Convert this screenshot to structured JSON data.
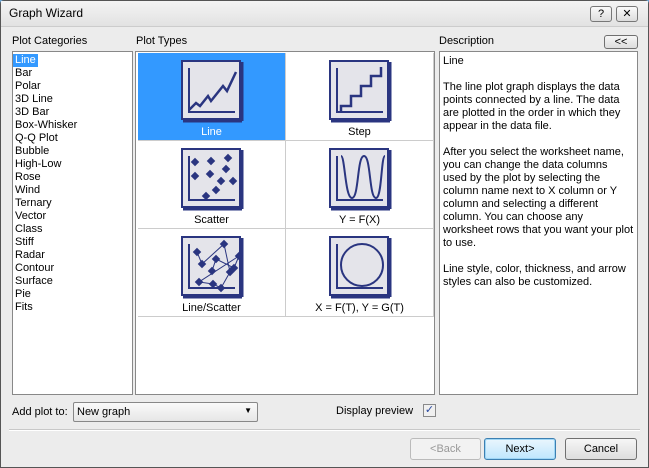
{
  "window": {
    "title": "Graph Wizard",
    "help_label": "?",
    "close_label": "✕"
  },
  "categories": {
    "label": "Plot Categories",
    "items": [
      "Line",
      "Bar",
      "Polar",
      "3D Line",
      "3D Bar",
      "Box-Whisker",
      "Q-Q Plot",
      "Bubble",
      "High-Low",
      "Rose",
      "Wind",
      "Ternary",
      "Vector",
      "Class",
      "Stiff",
      "Radar",
      "Contour",
      "Surface",
      "Pie",
      "Fits"
    ],
    "selected": "Line"
  },
  "plot_types": {
    "label": "Plot Types",
    "items": [
      {
        "label": "Line",
        "icon": "line-plot-icon"
      },
      {
        "label": "Step",
        "icon": "step-plot-icon"
      },
      {
        "label": "Scatter",
        "icon": "scatter-plot-icon"
      },
      {
        "label": "Y = F(X)",
        "icon": "function-plot-icon"
      },
      {
        "label": "Line/Scatter",
        "icon": "line-scatter-plot-icon"
      },
      {
        "label": "X = F(T), Y = G(T)",
        "icon": "parametric-plot-icon"
      }
    ],
    "selected": "Line"
  },
  "description": {
    "label": "Description",
    "collapse_label": "<<",
    "title": "Line",
    "paragraphs": [
      "The line plot graph displays the data points connected by a line.  The data are plotted in the order in which they appear in the data file.",
      "After you select the worksheet name, you can change the data columns used by the plot by selecting the column name next to X column or Y column and selecting a different column.  You can choose any worksheet rows that you want your plot to use.",
      "Line style, color, thickness, and arrow styles can also be customized."
    ]
  },
  "options": {
    "add_plot_label": "Add plot to:",
    "add_plot_value": "New graph",
    "display_preview_label": "Display preview",
    "display_preview_checked": true
  },
  "buttons": {
    "back": "<Back",
    "next": "Next>",
    "cancel": "Cancel"
  }
}
